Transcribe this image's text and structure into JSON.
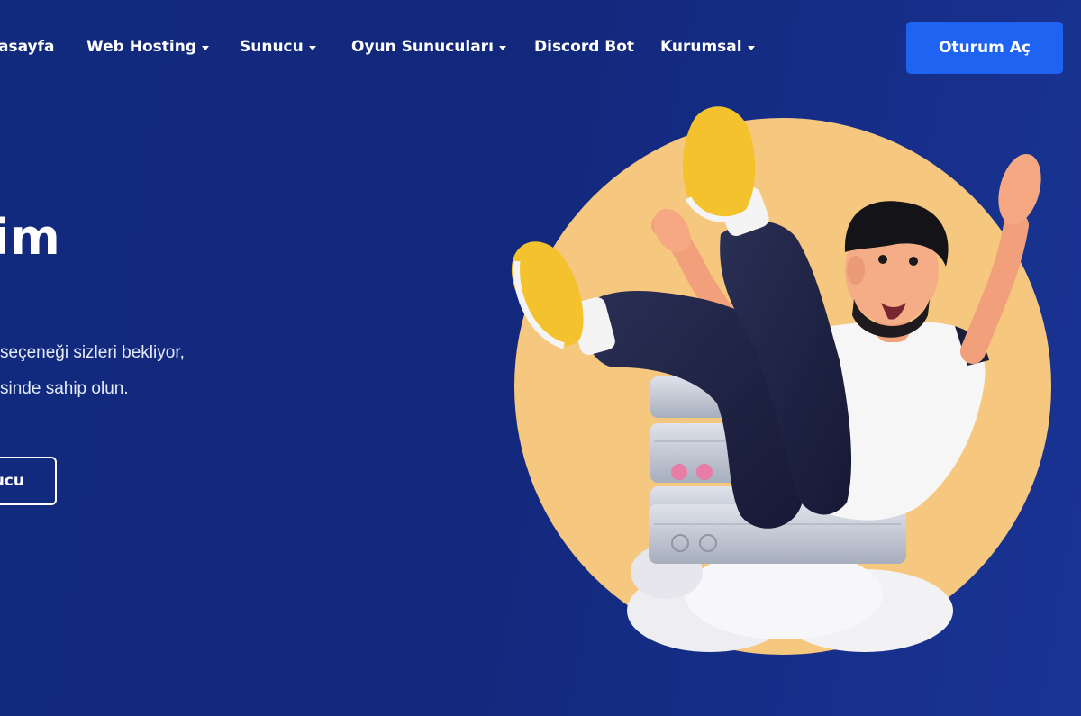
{
  "nav": {
    "items": [
      {
        "label": "asayfa",
        "has_caret": false
      },
      {
        "label": "Web Hosting",
        "has_caret": true
      },
      {
        "label": "Sunucu",
        "has_caret": true
      },
      {
        "label": "Oyun Sunucuları",
        "has_caret": true
      },
      {
        "label": "Discord Bot",
        "has_caret": false
      },
      {
        "label": "Kurumsal",
        "has_caret": true
      }
    ],
    "login_label": "Oturum Aç",
    "login_color": "#1f63f2"
  },
  "hero": {
    "title": "im",
    "line1": "seçeneği sizleri bekliyor,",
    "line2": "sinde sahip olun.",
    "button_label": "ucu"
  },
  "colors": {
    "background": "#122a7e",
    "accent_circle": "#f6c77e",
    "shoe": "#f3c22c"
  },
  "illustration": {
    "icon": "falling-man-on-server-icon"
  }
}
